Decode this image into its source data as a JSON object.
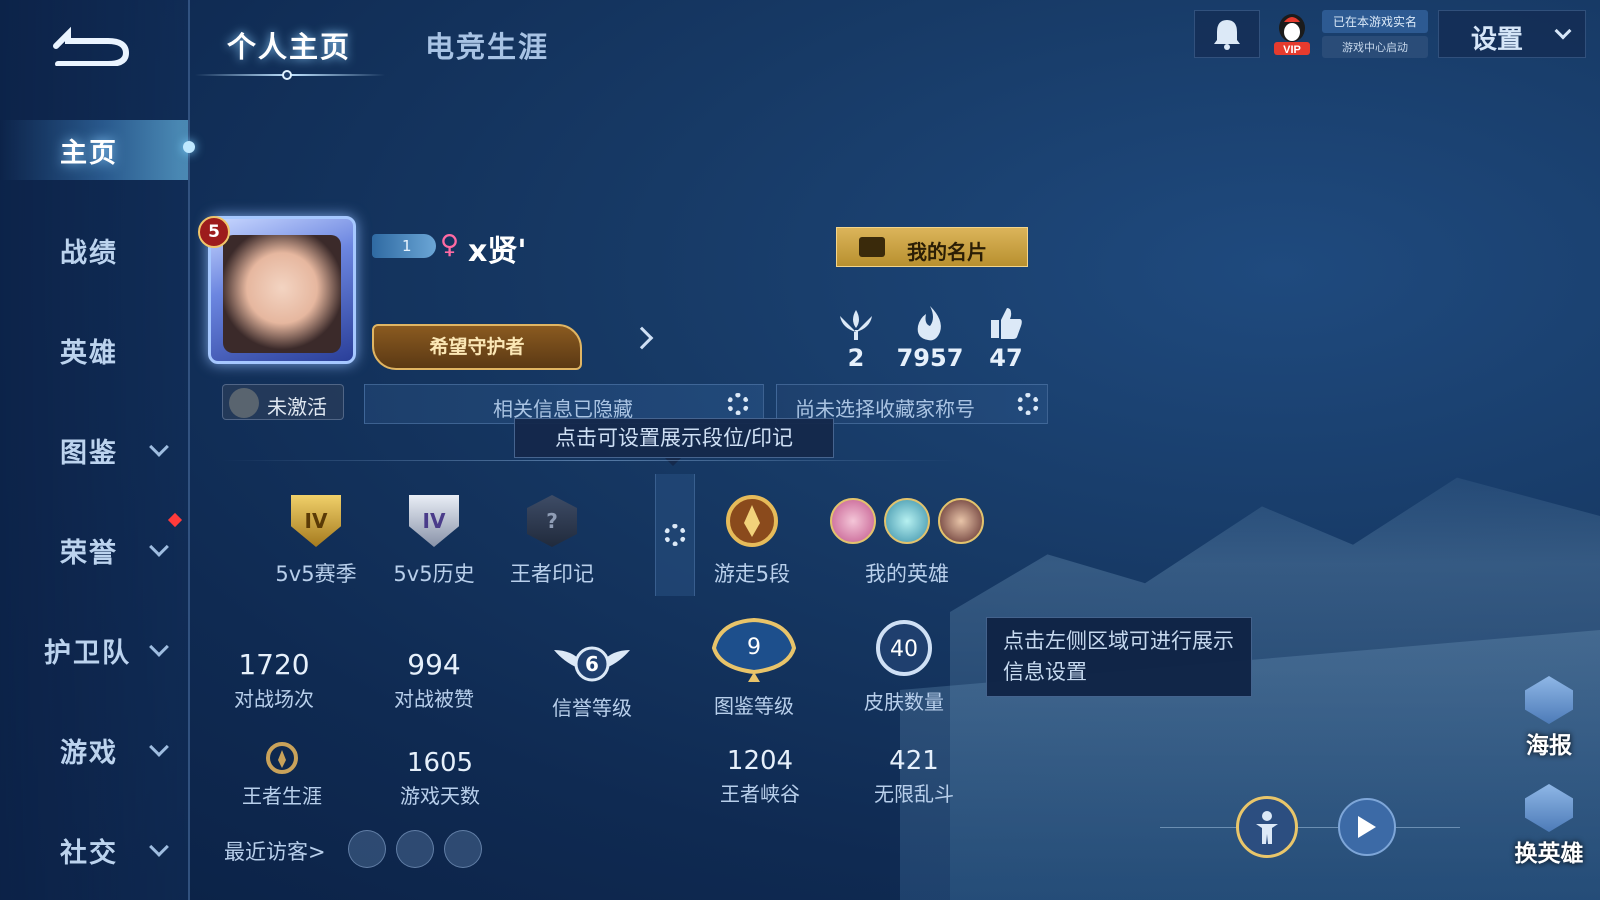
{
  "colors": {
    "accent": "#8fd0ff",
    "gold": "#dbb45a",
    "bg": "#173a66"
  },
  "tabs": [
    {
      "label": "个人主页",
      "active": true
    },
    {
      "label": "电竞生涯",
      "active": false
    }
  ],
  "header": {
    "icons": [
      "back-arrow-icon",
      "bell-icon",
      "vip-icon"
    ],
    "realname_top": "已在本游戏实名",
    "realname_bottom": "游戏中心启动",
    "settings_label": "设置"
  },
  "sidebar": {
    "items": [
      {
        "label": "主页",
        "active": true,
        "expandable": false
      },
      {
        "label": "战绩",
        "active": false,
        "expandable": false
      },
      {
        "label": "英雄",
        "active": false,
        "expandable": false
      },
      {
        "label": "图鉴",
        "active": false,
        "expandable": true
      },
      {
        "label": "荣誉",
        "active": false,
        "expandable": true
      },
      {
        "label": "护卫队",
        "active": false,
        "expandable": true
      },
      {
        "label": "游戏",
        "active": false,
        "expandable": true
      },
      {
        "label": "社交",
        "active": false,
        "expandable": true
      }
    ]
  },
  "profile": {
    "level": "5",
    "rank_chip": "1",
    "gender_icon": "♀",
    "username": "x贤'",
    "card_button": "我的名片",
    "title_badge": "希望守护者",
    "stats": [
      {
        "icon": "laurel-icon",
        "value": "2"
      },
      {
        "icon": "flame-icon",
        "value": "7957"
      },
      {
        "icon": "thumbs-up-icon",
        "value": "47"
      }
    ],
    "inactive_label": "未激活",
    "hidden_info": "相关信息已隐藏",
    "collector_title": "尚未选择收藏家称号",
    "tooltip": "点击可设置展示段位/印记"
  },
  "badges": [
    {
      "label": "5v5赛季",
      "mark": "IV"
    },
    {
      "label": "5v5历史",
      "mark": "IV"
    },
    {
      "label": "王者印记",
      "mark": "?"
    },
    {
      "label": "游走5段",
      "mark": ""
    },
    {
      "label": "我的英雄",
      "mark": ""
    }
  ],
  "numbers": [
    {
      "value": "1720",
      "label": "对战场次"
    },
    {
      "value": "994",
      "label": "对战被赞"
    },
    {
      "value": "6",
      "label": "信誉等级"
    },
    {
      "value": "9",
      "label": "图鉴等级"
    },
    {
      "value": "40",
      "label": "皮肤数量"
    }
  ],
  "numbers_row2": [
    {
      "value": "",
      "label": "王者生涯"
    },
    {
      "value": "1605",
      "label": "游戏天数"
    },
    {
      "value": "1204",
      "label": "王者峡谷"
    },
    {
      "value": "421",
      "label": "无限乱斗"
    }
  ],
  "info_tip": "点击左侧区域可进行展示信息设置",
  "recent_visitors": "最近访客>",
  "right_buttons": [
    {
      "label": "海报"
    },
    {
      "label": "换英雄"
    }
  ]
}
